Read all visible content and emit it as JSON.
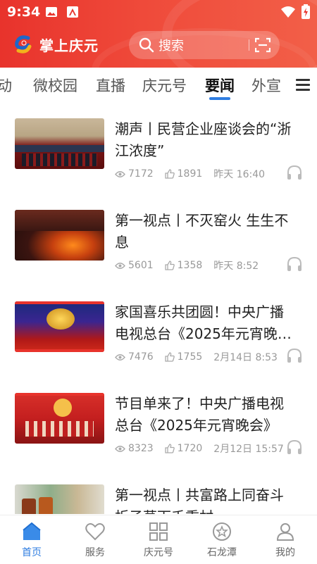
{
  "status_bar": {
    "time": "9:34"
  },
  "header": {
    "app_name": "掌上庆元",
    "search_placeholder": "搜索"
  },
  "tabs": [
    {
      "label": "动"
    },
    {
      "label": "微校园"
    },
    {
      "label": "直播"
    },
    {
      "label": "庆元号"
    },
    {
      "label": "要闻",
      "active": true
    },
    {
      "label": "外宣"
    }
  ],
  "articles": [
    {
      "title": "潮声丨民营企业座谈会的“浙江浓度”",
      "views": "7172",
      "likes": "1891",
      "time": "昨天 16:40"
    },
    {
      "title": "第一视点丨不灭窑火 生生不息",
      "views": "5601",
      "likes": "1358",
      "time": "昨天 8:52"
    },
    {
      "title": "家国喜乐共团圆！中央广播电视总台《2025年元宵晚会》",
      "views": "7476",
      "likes": "1755",
      "time": "2月14日 8:53"
    },
    {
      "title": "节目单来了！中央广播电视总台《2025年元宵晚会》",
      "views": "8323",
      "likes": "1720",
      "time": "2月12日 15:57"
    },
    {
      "title": "第一视点丨共富路上同奋斗 折子草下千重村",
      "views": "",
      "likes": "",
      "time": ""
    }
  ],
  "tabbar": [
    {
      "label": "首页",
      "active": true
    },
    {
      "label": "服务"
    },
    {
      "label": "庆元号"
    },
    {
      "label": "石龙潭"
    },
    {
      "label": "我的"
    }
  ],
  "colors": {
    "brand_red": "#e8332c",
    "accent_blue": "#2f7de1"
  }
}
